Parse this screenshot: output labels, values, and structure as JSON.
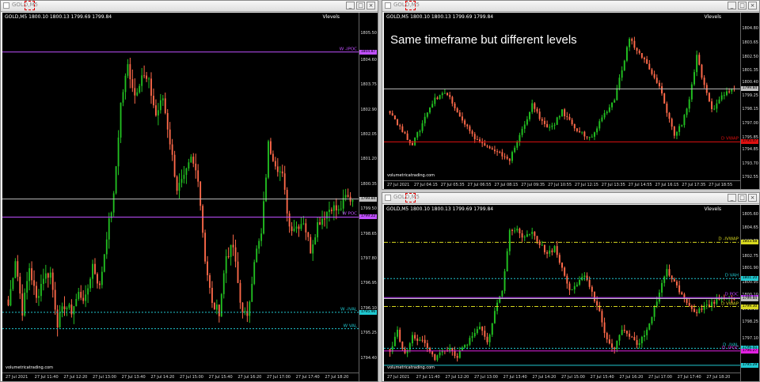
{
  "windows": [
    {
      "id": "w1",
      "title": "GOLD,M5",
      "info": "GOLD,M5  1800.10 1800.13 1799.69 1799.84",
      "vlevels": "Vlevels",
      "watermark": "volumetricatrading.com",
      "note": "",
      "ymin": 1793.9,
      "ymax": 1806.0,
      "yticks": [
        "1805.50",
        "1804.60",
        "1803.75",
        "1802.90",
        "1802.05",
        "1801.20",
        "1800.35",
        "1799.50",
        "1798.65",
        "1797.80",
        "1796.95",
        "1796.10",
        "1795.25",
        "1794.40"
      ],
      "ytickvals": [
        1805.5,
        1804.6,
        1803.75,
        1802.9,
        1802.05,
        1801.2,
        1800.35,
        1799.5,
        1798.65,
        1797.8,
        1796.95,
        1796.1,
        1795.25,
        1794.4
      ],
      "xticks": [
        "27 Jul 2021",
        "27 Jul 11:40",
        "27 Jul 12:20",
        "27 Jul 13:00",
        "27 Jul 13:40",
        "27 Jul 14:20",
        "27 Jul 15:00",
        "27 Jul 15:40",
        "27 Jul 16:20",
        "27 Jul 17:00",
        "27 Jul 17:40",
        "27 Jul 18:20"
      ],
      "levels": [
        {
          "label": "W -IPOC",
          "price": 1804.87,
          "color": "#c050ff",
          "style": "solid",
          "tag": "1804.87"
        },
        {
          "label": "",
          "price": 1799.84,
          "color": "#bdbdbd",
          "style": "solid",
          "tag": "1799.84"
        },
        {
          "label": "W POC",
          "price": 1799.22,
          "color": "#c050ff",
          "style": "solid",
          "tag": "1799.22"
        },
        {
          "label": "W -IVAL",
          "price": 1795.96,
          "color": "#20c8d0",
          "style": "dashed",
          "tag": "1795.96"
        },
        {
          "label": "W VAL",
          "price": 1795.4,
          "color": "#20c8d0",
          "style": "dashed",
          "tag": ""
        }
      ],
      "path": [
        1796.2,
        1797.8,
        1796.0,
        1797.5,
        1796.4,
        1797.2,
        1797.3,
        1795.6,
        1796.2,
        1796.0,
        1796.6,
        1796.4,
        1797.6,
        1796.8,
        1798.6,
        1799.9,
        1803.1,
        1804.4,
        1803.4,
        1804.1,
        1803.8,
        1802.7,
        1803.3,
        1801.8,
        1800.2,
        1800.5,
        1801.2,
        1800.6,
        1797.8,
        1796.2,
        1796.0,
        1797.9,
        1798.2,
        1796.3,
        1795.7,
        1797.8,
        1798.6,
        1801.7,
        1801.1,
        1800.6,
        1798.9,
        1798.9,
        1799.1,
        1798.1,
        1799.0,
        1799.3,
        1799.6,
        1799.4,
        1799.9,
        1799.8
      ]
    },
    {
      "id": "w2",
      "title": "GOLD,M5",
      "info": "GOLD,M5  1800.10 1800.13 1799.69 1799.84",
      "vlevels": "Vlevels",
      "watermark": "volumetricatrading.com",
      "note": "Same timeframe but different levels",
      "ymin": 1792.3,
      "ymax": 1805.6,
      "yticks": [
        "1804.80",
        "1803.65",
        "1802.50",
        "1801.35",
        "1800.40",
        "1799.25",
        "1798.15",
        "1797.00",
        "1795.85",
        "1794.85",
        "1793.70",
        "1792.55"
      ],
      "ytickvals": [
        1804.8,
        1803.65,
        1802.5,
        1801.35,
        1800.4,
        1799.25,
        1798.15,
        1797.0,
        1795.85,
        1794.85,
        1793.7,
        1792.55
      ],
      "xticks": [
        "27 Jul 2021",
        "27 Jul 04:15",
        "27 Jul 05:35",
        "27 Jul 06:55",
        "27 Jul 08:15",
        "27 Jul 09:35",
        "27 Jul 10:55",
        "27 Jul 12:15",
        "27 Jul 13:35",
        "27 Jul 14:55",
        "27 Jul 16:15",
        "27 Jul 17:35",
        "27 Jul 18:55"
      ],
      "levels": [
        {
          "label": "",
          "price": 1799.84,
          "color": "#bdbdbd",
          "style": "solid",
          "tag": "1799.84"
        },
        {
          "label": "D VWAP",
          "price": 1795.47,
          "color": "#e01010",
          "style": "solid",
          "tag": "1795.47"
        }
      ],
      "path": [
        1798.0,
        1797.0,
        1796.0,
        1795.3,
        1796.5,
        1798.0,
        1799.0,
        1799.5,
        1799.2,
        1798.0,
        1797.0,
        1796.0,
        1795.5,
        1795.0,
        1794.6,
        1794.4,
        1794.0,
        1795.5,
        1797.0,
        1798.5,
        1797.5,
        1796.5,
        1797.0,
        1798.0,
        1797.2,
        1796.5,
        1796.0,
        1795.8,
        1797.0,
        1798.0,
        1799.0,
        1801.5,
        1804.0,
        1803.0,
        1802.2,
        1801.0,
        1800.0,
        1798.0,
        1796.0,
        1797.0,
        1799.0,
        1802.5,
        1800.0,
        1798.0,
        1799.0,
        1799.6,
        1799.8
      ]
    },
    {
      "id": "w3",
      "title": "GOLD,M5",
      "info": "GOLD,M5  1800.10 1800.13 1799.69 1799.84",
      "vlevels": "Vlevels",
      "watermark": "volumetricatrading.com",
      "note": "",
      "ymin": 1794.8,
      "ymax": 1805.8,
      "yticks": [
        "1805.60",
        "1804.65",
        "1803.75",
        "1802.75",
        "1801.90",
        "1800.95",
        "1800.10",
        "1799.10",
        "1798.25",
        "1797.10",
        "1796.15",
        "1795.25"
      ],
      "ytickvals": [
        1805.6,
        1804.65,
        1803.75,
        1802.75,
        1801.9,
        1800.95,
        1800.1,
        1799.1,
        1798.25,
        1797.1,
        1796.15,
        1795.25
      ],
      "xticks": [
        "27 Jul 2021",
        "27 Jul 11:40",
        "27 Jul 12:20",
        "27 Jul 13:00",
        "27 Jul 13:40",
        "27 Jul 14:20",
        "27 Jul 15:00",
        "27 Jul 15:40",
        "27 Jul 16:20",
        "27 Jul 17:00",
        "27 Jul 17:40",
        "27 Jul 18:20"
      ],
      "levels": [
        {
          "label": "D -IVWAP",
          "price": 1803.68,
          "color": "#d8d820",
          "style": "dashdot",
          "tag": "1803.68"
        },
        {
          "label": "D VAH",
          "price": 1801.2,
          "color": "#20c8d0",
          "style": "dashed",
          "tag": "1801.20"
        },
        {
          "label": "D POC",
          "price": 1799.91,
          "color": "#c040ff",
          "style": "solid",
          "tag": "1799.91"
        },
        {
          "label": "",
          "price": 1799.84,
          "color": "#bdbdbd",
          "style": "solid",
          "tag": "1799.84"
        },
        {
          "label": "D VWAP",
          "price": 1799.3,
          "color": "#d8d820",
          "style": "dashdot",
          "tag": "1799.30"
        },
        {
          "label": "D -IVAL",
          "price": 1796.45,
          "color": "#20c8d0",
          "style": "dashed",
          "tag": "1796.45"
        },
        {
          "label": "D -IPOC",
          "price": 1796.27,
          "color": "#e020e0",
          "style": "solid",
          "tag": "1796.27"
        },
        {
          "label": "",
          "price": 1795.29,
          "color": "#20c8d0",
          "style": "solid",
          "tag": "1795.29"
        }
      ],
      "path": [
        1796.2,
        1797.6,
        1796.0,
        1797.2,
        1797.0,
        1796.6,
        1795.8,
        1796.2,
        1796.4,
        1795.9,
        1796.6,
        1797.2,
        1797.9,
        1796.8,
        1799.0,
        1800.4,
        1804.4,
        1804.7,
        1803.9,
        1804.4,
        1803.6,
        1802.9,
        1803.3,
        1801.9,
        1800.5,
        1800.9,
        1801.3,
        1800.3,
        1798.9,
        1796.9,
        1796.4,
        1797.6,
        1797.3,
        1796.7,
        1797.3,
        1798.7,
        1800.2,
        1801.9,
        1800.9,
        1800.2,
        1799.4,
        1798.9,
        1799.3,
        1799.5,
        1799.9,
        1800.0,
        1799.8
      ]
    }
  ]
}
